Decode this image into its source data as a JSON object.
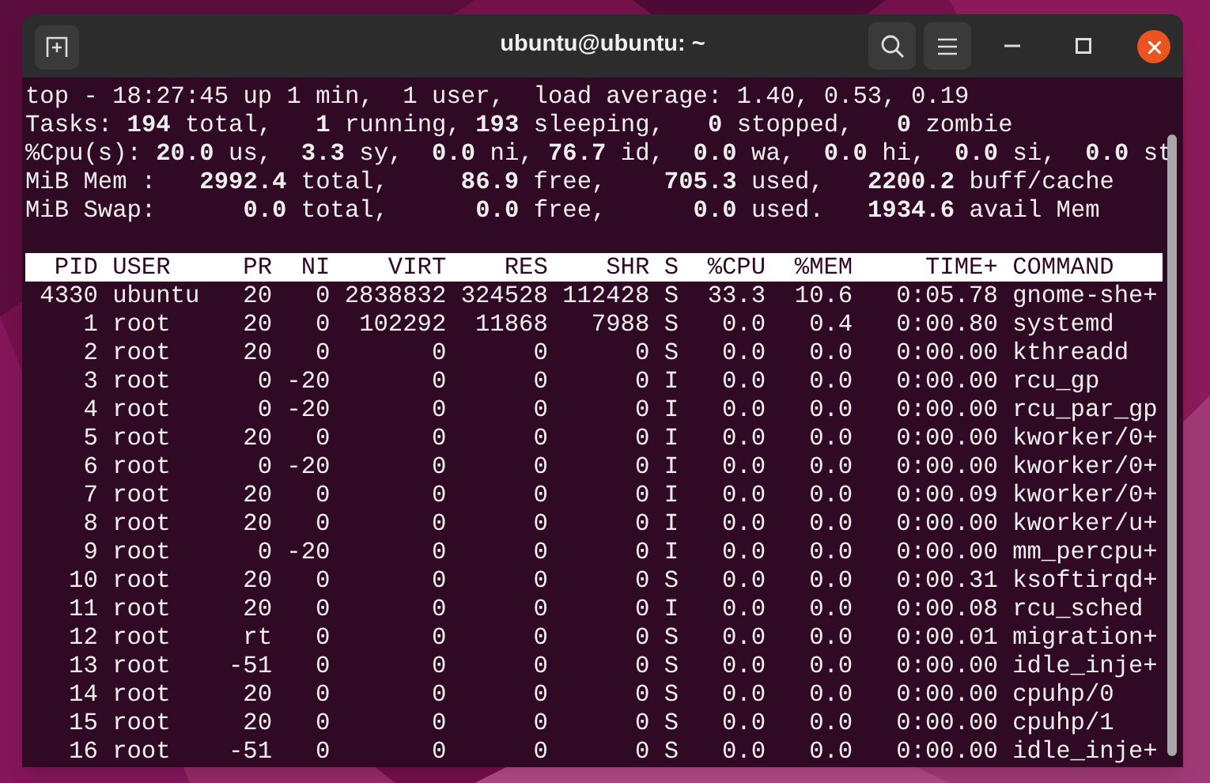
{
  "window": {
    "title": "ubuntu@ubuntu: ~"
  },
  "summary": [
    "top - 18:27:45 up 1 min,  1 user,  load average: 1.40, 0.53, 0.19",
    "Tasks: **194** total,   **1** running, **193** sleeping,   **0** stopped,   **0** zombie",
    "%Cpu(s): **20.0** us,  **3.3** sy,  **0.0** ni, **76.7** id,  **0.0** wa,  **0.0** hi,  **0.0** si,  **0.0** st",
    "MiB Mem :   **2992.4** total,     **86.9** free,    **705.3** used,   **2200.2** buff/cache",
    "MiB Swap:      **0.0** total,      **0.0** free,      **0.0** used.   **1934.6** avail Mem"
  ],
  "table": {
    "columns": [
      "PID",
      "USER",
      "PR",
      "NI",
      "VIRT",
      "RES",
      "SHR",
      "S",
      "%CPU",
      "%MEM",
      "TIME+",
      "COMMAND"
    ],
    "rows": [
      [
        "4330",
        "ubuntu",
        "20",
        "0",
        "2838832",
        "324528",
        "112428",
        "S",
        "33.3",
        "10.6",
        "0:05.78",
        "gnome-she+"
      ],
      [
        "1",
        "root",
        "20",
        "0",
        "102292",
        "11868",
        "7988",
        "S",
        "0.0",
        "0.4",
        "0:00.80",
        "systemd"
      ],
      [
        "2",
        "root",
        "20",
        "0",
        "0",
        "0",
        "0",
        "S",
        "0.0",
        "0.0",
        "0:00.00",
        "kthreadd"
      ],
      [
        "3",
        "root",
        "0",
        "-20",
        "0",
        "0",
        "0",
        "I",
        "0.0",
        "0.0",
        "0:00.00",
        "rcu_gp"
      ],
      [
        "4",
        "root",
        "0",
        "-20",
        "0",
        "0",
        "0",
        "I",
        "0.0",
        "0.0",
        "0:00.00",
        "rcu_par_gp"
      ],
      [
        "5",
        "root",
        "20",
        "0",
        "0",
        "0",
        "0",
        "I",
        "0.0",
        "0.0",
        "0:00.00",
        "kworker/0+"
      ],
      [
        "6",
        "root",
        "0",
        "-20",
        "0",
        "0",
        "0",
        "I",
        "0.0",
        "0.0",
        "0:00.00",
        "kworker/0+"
      ],
      [
        "7",
        "root",
        "20",
        "0",
        "0",
        "0",
        "0",
        "I",
        "0.0",
        "0.0",
        "0:00.09",
        "kworker/0+"
      ],
      [
        "8",
        "root",
        "20",
        "0",
        "0",
        "0",
        "0",
        "I",
        "0.0",
        "0.0",
        "0:00.00",
        "kworker/u+"
      ],
      [
        "9",
        "root",
        "0",
        "-20",
        "0",
        "0",
        "0",
        "I",
        "0.0",
        "0.0",
        "0:00.00",
        "mm_percpu+"
      ],
      [
        "10",
        "root",
        "20",
        "0",
        "0",
        "0",
        "0",
        "S",
        "0.0",
        "0.0",
        "0:00.31",
        "ksoftirqd+"
      ],
      [
        "11",
        "root",
        "20",
        "0",
        "0",
        "0",
        "0",
        "I",
        "0.0",
        "0.0",
        "0:00.08",
        "rcu_sched"
      ],
      [
        "12",
        "root",
        "rt",
        "0",
        "0",
        "0",
        "0",
        "S",
        "0.0",
        "0.0",
        "0:00.01",
        "migration+"
      ],
      [
        "13",
        "root",
        "-51",
        "0",
        "0",
        "0",
        "0",
        "S",
        "0.0",
        "0.0",
        "0:00.00",
        "idle_inje+"
      ],
      [
        "14",
        "root",
        "20",
        "0",
        "0",
        "0",
        "0",
        "S",
        "0.0",
        "0.0",
        "0:00.00",
        "cpuhp/0"
      ],
      [
        "15",
        "root",
        "20",
        "0",
        "0",
        "0",
        "0",
        "S",
        "0.0",
        "0.0",
        "0:00.00",
        "cpuhp/1"
      ],
      [
        "16",
        "root",
        "-51",
        "0",
        "0",
        "0",
        "0",
        "S",
        "0.0",
        "0.0",
        "0:00.00",
        "idle_inje+"
      ]
    ]
  }
}
